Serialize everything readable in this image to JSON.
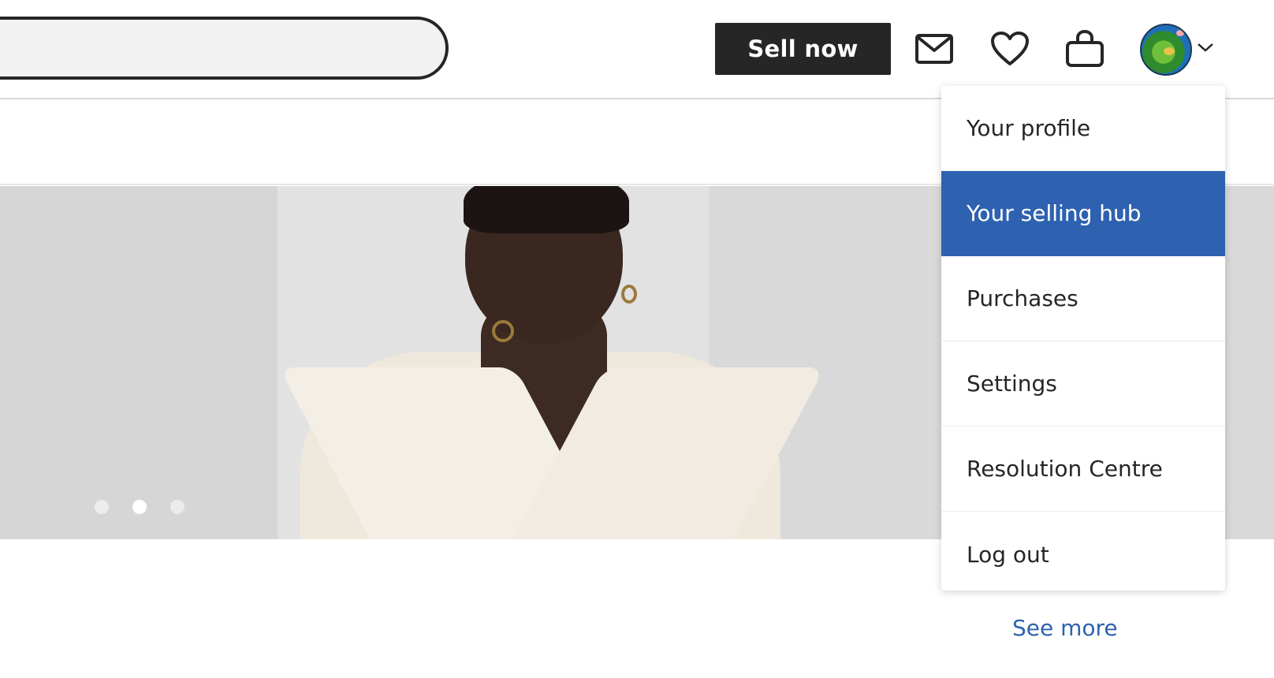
{
  "header": {
    "search": {
      "value": "",
      "placeholder": ""
    },
    "sell_now_label": "Sell now",
    "icons": {
      "messages": "mail-icon",
      "favourites": "heart-icon",
      "basket": "bag-icon",
      "account_caret": "chevron-down-icon"
    }
  },
  "hero": {
    "carousel": {
      "slide_count": 3,
      "active_slide": 2
    }
  },
  "account_menu": {
    "items": [
      {
        "label": "Your profile",
        "selected": false
      },
      {
        "label": "Your selling hub",
        "selected": true
      },
      {
        "label": "Purchases",
        "selected": false
      },
      {
        "label": "Settings",
        "selected": false
      },
      {
        "label": "Resolution Centre",
        "selected": false
      },
      {
        "label": "Log out",
        "selected": false
      }
    ]
  },
  "see_more_label": "See more",
  "colors": {
    "accent": "#2e62b1",
    "dark": "#262626",
    "search_bg": "#f2f2f2"
  }
}
